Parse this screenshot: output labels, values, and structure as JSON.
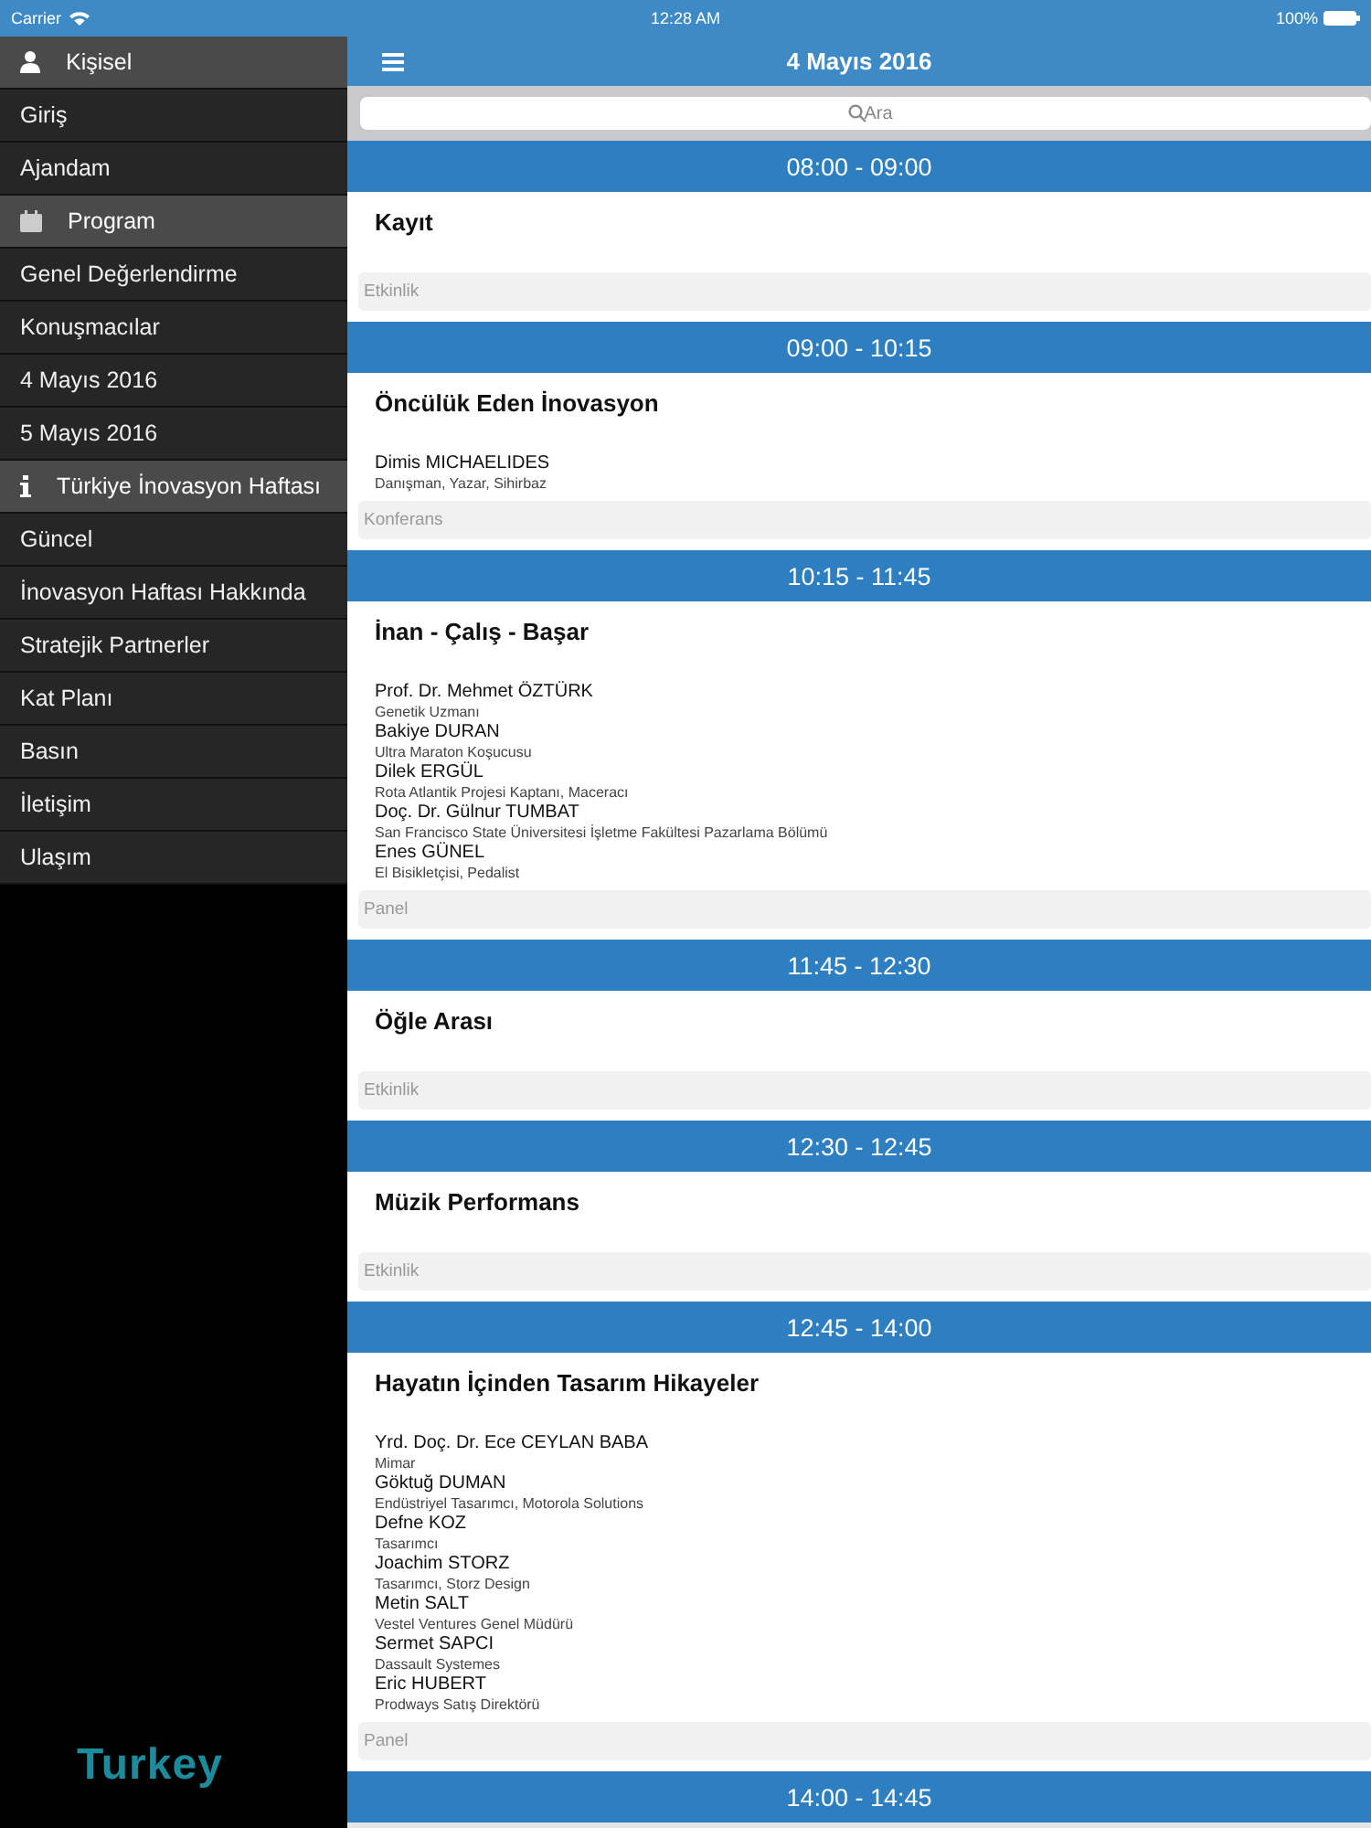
{
  "status_bar": {
    "carrier": "Carrier",
    "time": "12:28 AM",
    "battery": "100%"
  },
  "sidebar": {
    "items": [
      {
        "kind": "header",
        "label": "Kişisel"
      },
      {
        "kind": "item",
        "label": "Giriş"
      },
      {
        "kind": "item",
        "label": "Ajandam"
      },
      {
        "kind": "header",
        "label": "Program"
      },
      {
        "kind": "item",
        "label": "Genel Değerlendirme"
      },
      {
        "kind": "item",
        "label": "Konuşmacılar"
      },
      {
        "kind": "item",
        "label": "4 Mayıs 2016"
      },
      {
        "kind": "item",
        "label": "5 Mayıs 2016"
      },
      {
        "kind": "header",
        "label": "Türkiye İnovasyon Haftası"
      },
      {
        "kind": "item",
        "label": "Güncel"
      },
      {
        "kind": "item",
        "label": "İnovasyon Haftası Hakkında"
      },
      {
        "kind": "item",
        "label": "Stratejik Partnerler"
      },
      {
        "kind": "item",
        "label": "Kat Planı"
      },
      {
        "kind": "item",
        "label": "Basın"
      },
      {
        "kind": "item",
        "label": "İletişim"
      },
      {
        "kind": "item",
        "label": "Ulaşım"
      }
    ],
    "logo": "Turkey"
  },
  "nav_bar": {
    "title": "4 Mayıs 2016"
  },
  "search": {
    "placeholder": "Ara"
  },
  "sessions": [
    {
      "time": "08:00 - 09:00",
      "title": "Kayıt",
      "type": "Etkinlik"
    },
    {
      "time": "09:00 - 10:15",
      "title": "Öncülük Eden İnovasyon",
      "speakers": [
        {
          "name": "Dimis MICHAELIDES",
          "role": "Danışman, Yazar, Sihirbaz"
        }
      ],
      "type": "Konferans"
    },
    {
      "time": "10:15 - 11:45",
      "title": "İnan - Çalış - Başar",
      "speakers": [
        {
          "name": "Prof. Dr. Mehmet ÖZTÜRK",
          "role": "Genetik Uzmanı"
        },
        {
          "name": "Bakiye DURAN",
          "role": "Ultra Maraton Koşucusu"
        },
        {
          "name": "Dilek ERGÜL",
          "role": "Rota Atlantik Projesi Kaptanı, Maceracı"
        },
        {
          "name": "Doç. Dr. Gülnur TUMBAT",
          "role": "San Francisco State Üniversitesi İşletme Fakültesi Pazarlama Bölümü"
        },
        {
          "name": "Enes GÜNEL",
          "role": "El Bisikletçisi, Pedalist"
        }
      ],
      "type": "Panel"
    },
    {
      "time": "11:45 - 12:30",
      "title": "Öğle Arası",
      "type": "Etkinlik"
    },
    {
      "time": "12:30 - 12:45",
      "title": "Müzik Performans",
      "type": "Etkinlik"
    },
    {
      "time": "12:45 - 14:00",
      "title": "Hayatın İçinden Tasarım Hikayeler",
      "speakers": [
        {
          "name": "Yrd. Doç. Dr. Ece CEYLAN BABA",
          "role": "Mimar"
        },
        {
          "name": "Göktuğ DUMAN",
          "role": "Endüstriyel Tasarımcı, Motorola Solutions"
        },
        {
          "name": "Defne KOZ",
          "role": "Tasarımcı"
        },
        {
          "name": "Joachim STORZ",
          "role": "Tasarımcı, Storz Design"
        },
        {
          "name": "Metin SALT",
          "role": "Vestel Ventures Genel Müdürü"
        },
        {
          "name": "Sermet SAPCI",
          "role": "Dassault Systemes"
        },
        {
          "name": "Eric HUBERT",
          "role": "Prodways Satış Direktörü"
        }
      ],
      "type": "Panel"
    },
    {
      "time": "14:00 - 14:45"
    }
  ]
}
